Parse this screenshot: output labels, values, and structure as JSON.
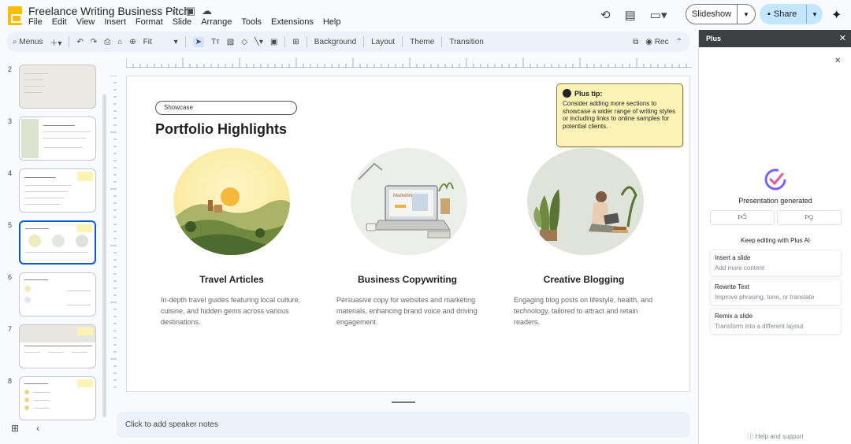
{
  "doc": {
    "title": "Freelance Writing Business Pitch"
  },
  "menu": [
    "File",
    "Edit",
    "View",
    "Insert",
    "Format",
    "Slide",
    "Arrange",
    "Tools",
    "Extensions",
    "Help"
  ],
  "header": {
    "slideshow_label": "Slideshow",
    "share_label": "Share"
  },
  "toolbar": {
    "menus_label": "Menus",
    "zoom_label": "Fit",
    "background_label": "Background",
    "layout_label": "Layout",
    "theme_label": "Theme",
    "transition_label": "Transition",
    "rec_label": "Rec"
  },
  "filmstrip": {
    "slides": [
      {
        "num": "2"
      },
      {
        "num": "3"
      },
      {
        "num": "4"
      },
      {
        "num": "5"
      },
      {
        "num": "6"
      },
      {
        "num": "7"
      },
      {
        "num": "8"
      }
    ],
    "selected": "5"
  },
  "slide": {
    "tag": "Showcase",
    "title": "Portfolio Highlights",
    "tip_title": "Plus tip:",
    "tip_body": "Consider adding more sections to showcase a wider range of writing styles or including links to online samples for potential clients.",
    "columns": [
      {
        "title": "Travel Articles",
        "text": "In-depth travel guides featuring local culture, cuisine, and hidden gems across various destinations."
      },
      {
        "title": "Business Copywriting",
        "text": "Persuasive copy for websites and marketing materials, enhancing brand voice and driving engagement."
      },
      {
        "title": "Creative Blogging",
        "text": "Engaging blog posts on lifestyle, health, and technology, tailored to attract and retain readers."
      }
    ],
    "laptop_screen_label": "Marketing"
  },
  "notes": {
    "placeholder": "Click to add speaker notes"
  },
  "panel": {
    "title": "Plus",
    "generated": "Presentation generated",
    "keep_editing": "Keep editing with Plus AI",
    "actions": [
      {
        "title": "Insert a slide",
        "subtitle": "Add more content"
      },
      {
        "title": "Rewrite Text",
        "subtitle": "Improve phrasing, tone, or translate"
      },
      {
        "title": "Remix a slide",
        "subtitle": "Transform into a different layout"
      }
    ],
    "help": "Help and support"
  },
  "colors": {
    "accent": "#0b57d0",
    "share_bg": "#c2e7ff",
    "tip_bg": "#fdf3b5",
    "panel_header": "#3c4043"
  }
}
